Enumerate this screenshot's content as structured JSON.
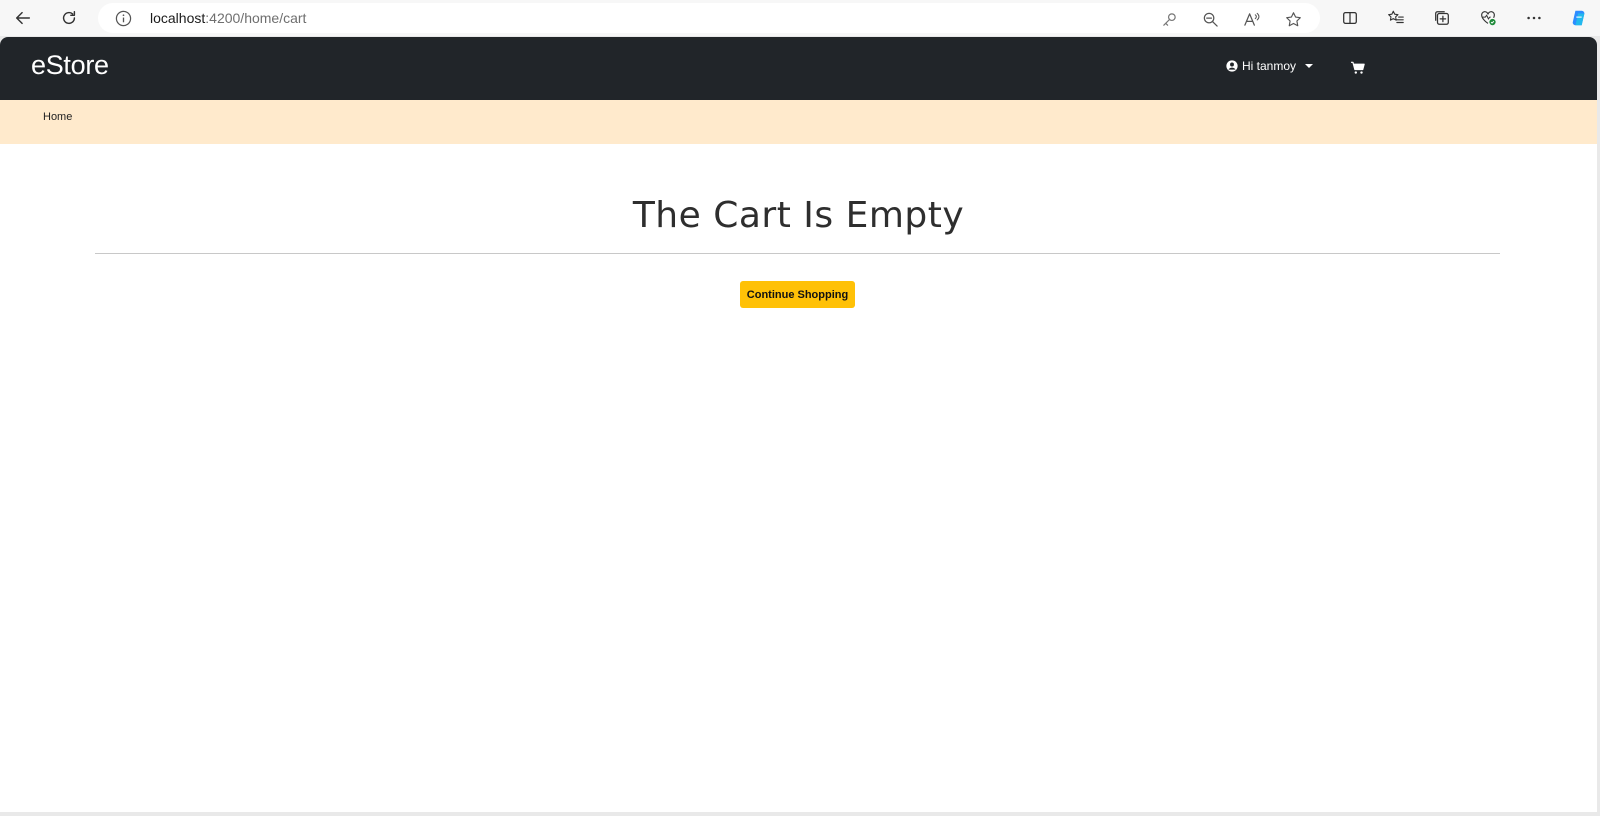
{
  "browser": {
    "url_host": "localhost",
    "url_path": ":4200/home/cart"
  },
  "navbar": {
    "brand": "eStore",
    "greeting": "Hi tanmoy"
  },
  "breadcrumb": {
    "home_label": "Home"
  },
  "cart": {
    "title": "The Cart Is Empty",
    "continue_label": "Continue Shopping"
  },
  "colors": {
    "navbar_bg": "#212529",
    "breadcrumb_bg": "#ffeacc",
    "button_bg": "#ffc107"
  },
  "icons": {
    "back": "back-arrow-icon",
    "refresh": "refresh-icon",
    "info": "info-icon",
    "key": "key-icon",
    "zoom": "zoom-out-icon",
    "read_aloud": "read-aloud-icon",
    "favorite": "star-icon",
    "split": "split-screen-icon",
    "favorites": "favorites-list-icon",
    "collections": "collections-icon",
    "health": "browser-health-icon",
    "more": "more-icon",
    "copilot": "copilot-icon",
    "user": "user-circle-icon",
    "cart": "shopping-cart-icon"
  }
}
